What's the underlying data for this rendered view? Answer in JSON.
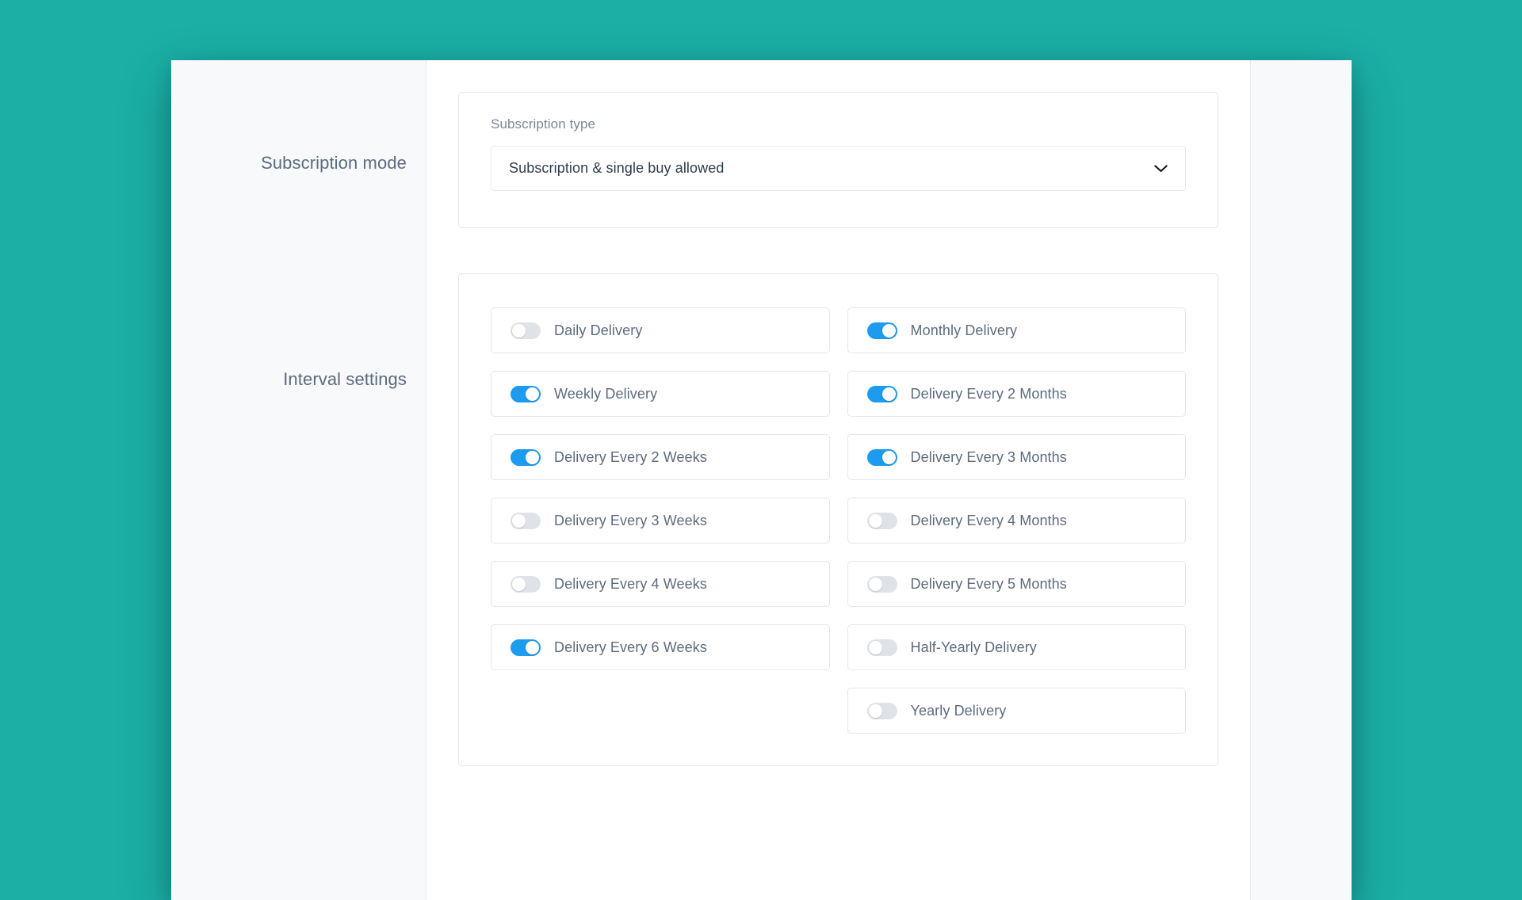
{
  "theme": {
    "page_background": "#1BAFA6",
    "card_background": "#ffffff",
    "rail_background": "#f7f9fa",
    "toggle_on_color": "#1C9BEF",
    "toggle_off_color": "#dfe3e8",
    "label_color": "#5d6b7e"
  },
  "sections": {
    "subscription_mode": {
      "rail_label": "Subscription mode",
      "field_label": "Subscription type",
      "selected_value": "Subscription & single buy allowed",
      "dropdown_icon": "chevron-down-icon"
    },
    "interval_settings": {
      "rail_label": "Interval settings",
      "left_column": [
        {
          "label": "Daily Delivery",
          "enabled": false
        },
        {
          "label": "Weekly Delivery",
          "enabled": true
        },
        {
          "label": "Delivery Every 2 Weeks",
          "enabled": true
        },
        {
          "label": "Delivery Every 3 Weeks",
          "enabled": false
        },
        {
          "label": "Delivery Every 4 Weeks",
          "enabled": false
        },
        {
          "label": "Delivery Every 6 Weeks",
          "enabled": true
        }
      ],
      "right_column": [
        {
          "label": "Monthly Delivery",
          "enabled": true
        },
        {
          "label": "Delivery Every 2 Months",
          "enabled": true
        },
        {
          "label": "Delivery Every 3 Months",
          "enabled": true
        },
        {
          "label": "Delivery Every 4 Months",
          "enabled": false
        },
        {
          "label": "Delivery Every 5 Months",
          "enabled": false
        },
        {
          "label": "Half-Yearly Delivery",
          "enabled": false
        },
        {
          "label": "Yearly Delivery",
          "enabled": false
        }
      ]
    }
  }
}
